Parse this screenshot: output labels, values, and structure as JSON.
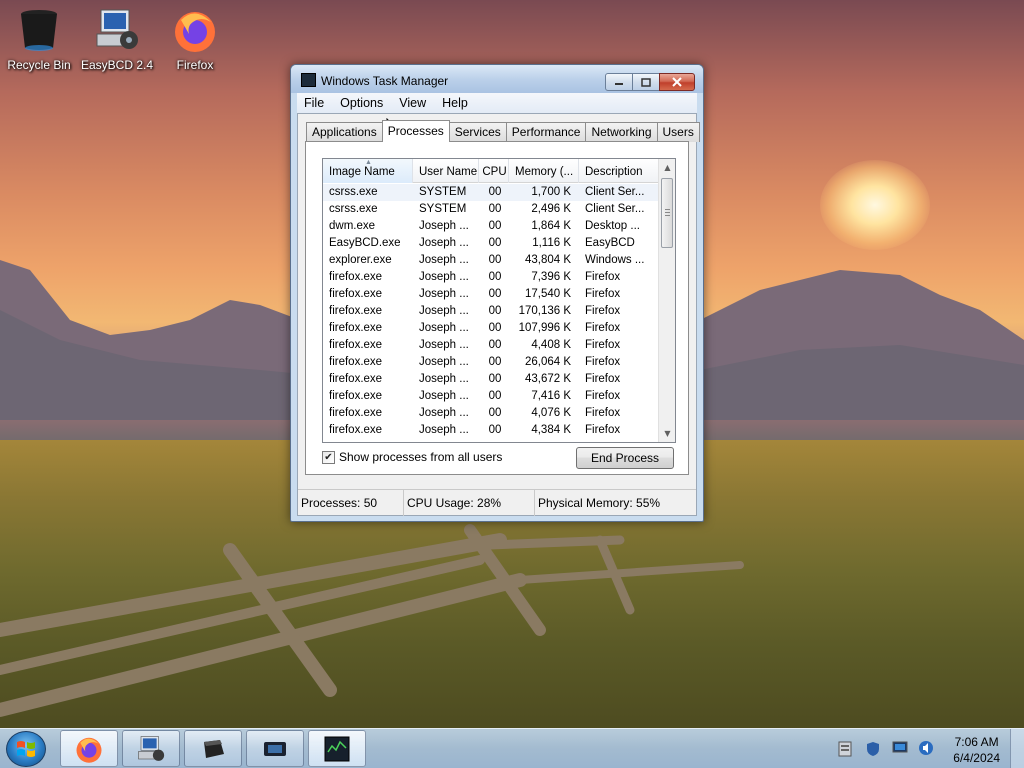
{
  "desktop": {
    "icons": [
      {
        "label": "Recycle Bin",
        "icon": "recycle-bin-icon"
      },
      {
        "label": "EasyBCD 2.4",
        "icon": "easybcd-icon"
      },
      {
        "label": "Firefox",
        "icon": "firefox-icon"
      }
    ]
  },
  "window": {
    "title": "Windows Task Manager",
    "menu": [
      "File",
      "Options",
      "View",
      "Help"
    ],
    "tabs": [
      "Applications",
      "Processes",
      "Services",
      "Performance",
      "Networking",
      "Users"
    ],
    "active_tab": "Processes",
    "columns": [
      "Image Name",
      "User Name",
      "CPU",
      "Memory (...",
      "Description"
    ],
    "rows": [
      {
        "name": "csrss.exe",
        "user": "SYSTEM",
        "cpu": "00",
        "mem": "1,700 K",
        "desc": "Client Ser..."
      },
      {
        "name": "csrss.exe",
        "user": "SYSTEM",
        "cpu": "00",
        "mem": "2,496 K",
        "desc": "Client Ser..."
      },
      {
        "name": "dwm.exe",
        "user": "Joseph ...",
        "cpu": "00",
        "mem": "1,864 K",
        "desc": "Desktop ..."
      },
      {
        "name": "EasyBCD.exe",
        "user": "Joseph ...",
        "cpu": "00",
        "mem": "1,116 K",
        "desc": "EasyBCD"
      },
      {
        "name": "explorer.exe",
        "user": "Joseph ...",
        "cpu": "00",
        "mem": "43,804 K",
        "desc": "Windows ..."
      },
      {
        "name": "firefox.exe",
        "user": "Joseph ...",
        "cpu": "00",
        "mem": "7,396 K",
        "desc": "Firefox"
      },
      {
        "name": "firefox.exe",
        "user": "Joseph ...",
        "cpu": "00",
        "mem": "17,540 K",
        "desc": "Firefox"
      },
      {
        "name": "firefox.exe",
        "user": "Joseph ...",
        "cpu": "00",
        "mem": "170,136 K",
        "desc": "Firefox"
      },
      {
        "name": "firefox.exe",
        "user": "Joseph ...",
        "cpu": "00",
        "mem": "107,996 K",
        "desc": "Firefox"
      },
      {
        "name": "firefox.exe",
        "user": "Joseph ...",
        "cpu": "00",
        "mem": "4,408 K",
        "desc": "Firefox"
      },
      {
        "name": "firefox.exe",
        "user": "Joseph ...",
        "cpu": "00",
        "mem": "26,064 K",
        "desc": "Firefox"
      },
      {
        "name": "firefox.exe",
        "user": "Joseph ...",
        "cpu": "00",
        "mem": "43,672 K",
        "desc": "Firefox"
      },
      {
        "name": "firefox.exe",
        "user": "Joseph ...",
        "cpu": "00",
        "mem": "7,416 K",
        "desc": "Firefox"
      },
      {
        "name": "firefox.exe",
        "user": "Joseph ...",
        "cpu": "00",
        "mem": "4,076 K",
        "desc": "Firefox"
      },
      {
        "name": "firefox.exe",
        "user": "Joseph ...",
        "cpu": "00",
        "mem": "4,384 K",
        "desc": "Firefox"
      }
    ],
    "show_all_label": "Show processes from all users",
    "show_all_checked": true,
    "end_process_label": "End Process",
    "status": {
      "processes": "Processes: 50",
      "cpu": "CPU Usage: 28%",
      "memory": "Physical Memory: 55%"
    }
  },
  "taskbar": {
    "buttons": [
      "firefox-icon",
      "easybcd-icon",
      "generic-app-icon",
      "display-app-icon",
      "task-manager-icon"
    ],
    "clock_time": "7:06 AM",
    "clock_date": "6/4/2024",
    "tray_icons": [
      "action-center-icon",
      "security-shield-icon",
      "network-icon",
      "volume-icon"
    ]
  },
  "colors": {
    "title_gradient_top": "#dbe8f6",
    "close_button": "#c0402c",
    "selected_row": "#eef3fa"
  }
}
